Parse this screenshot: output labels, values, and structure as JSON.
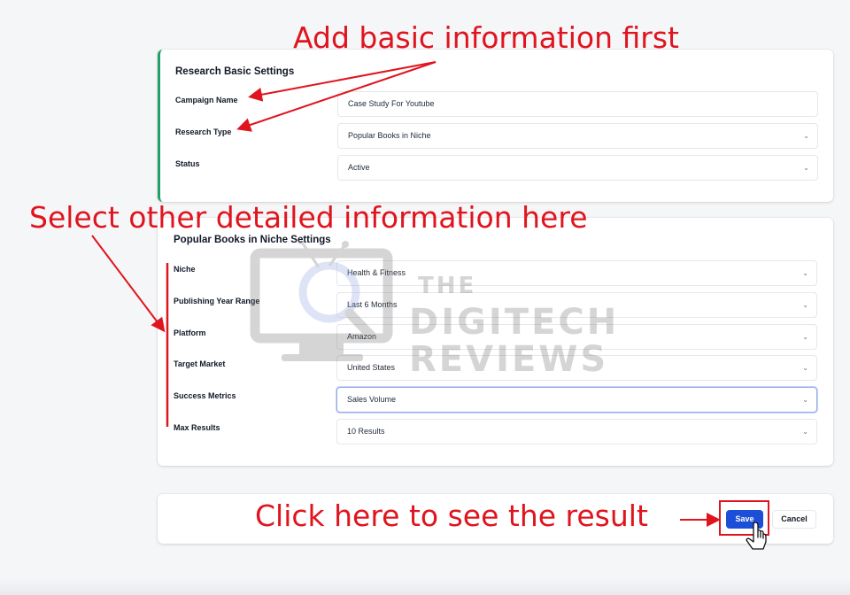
{
  "annotations": {
    "basic": "Add basic information first",
    "detail": "Select other detailed information here",
    "result": "Click here to see the result"
  },
  "basic_settings": {
    "title": "Research Basic Settings",
    "fields": [
      {
        "label": "Campaign Name",
        "value": "Case Study For Youtube",
        "type": "text"
      },
      {
        "label": "Research Type",
        "value": "Popular Books in Niche",
        "type": "select"
      },
      {
        "label": "Status",
        "value": "Active",
        "type": "select"
      }
    ]
  },
  "niche_settings": {
    "title": "Popular Books in Niche Settings",
    "fields": [
      {
        "label": "Niche",
        "value": "Health & Fitness",
        "type": "select"
      },
      {
        "label": "Publishing Year Range",
        "value": "Last 6 Months",
        "type": "select"
      },
      {
        "label": "Platform",
        "value": "Amazon",
        "type": "select"
      },
      {
        "label": "Target Market",
        "value": "United States",
        "type": "select"
      },
      {
        "label": "Success Metrics",
        "value": "Sales Volume",
        "type": "select",
        "focused": true
      },
      {
        "label": "Max Results",
        "value": "10 Results",
        "type": "select"
      }
    ]
  },
  "actions": {
    "save_label": "Save",
    "cancel_label": "Cancel"
  },
  "watermark": {
    "line1": "THE",
    "line2": "DIGITECH",
    "line3": "REVIEWS"
  },
  "icons": {
    "dropdown": "chevron-down-icon",
    "cursor": "hand-pointer-icon",
    "watermark": "monitor-magnifier-icon"
  },
  "colors": {
    "annotation": "#e0141e",
    "accent_green": "#22a06b",
    "primary_button": "#1d4ed8"
  }
}
